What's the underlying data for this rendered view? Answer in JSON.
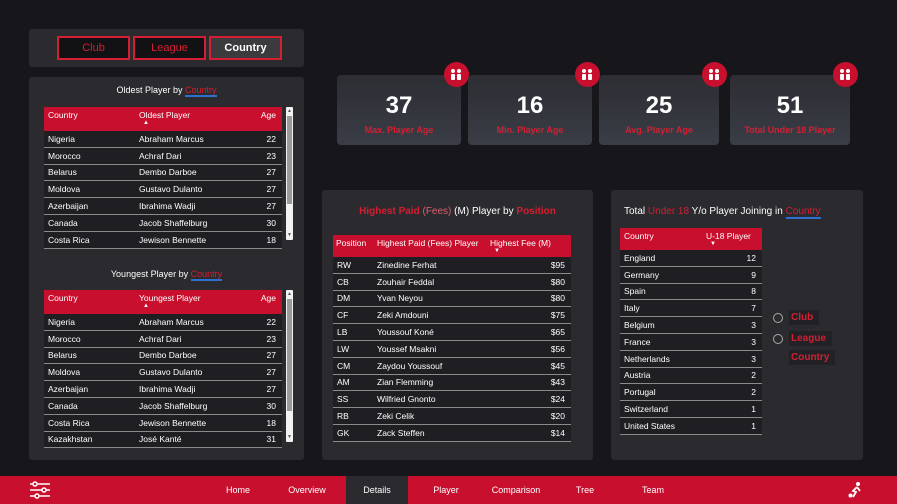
{
  "slicer": {
    "club": "Club",
    "league": "League",
    "country": "Country"
  },
  "oldest": {
    "title_prefix": "Oldest Player by ",
    "title_hl": "Country",
    "headers": {
      "country": "Country",
      "player": "Oldest Player",
      "age": "Age"
    },
    "rows": [
      {
        "country": "Nigeria",
        "player": "Abraham Marcus",
        "age": "22"
      },
      {
        "country": "Morocco",
        "player": "Achraf Dari",
        "age": "23"
      },
      {
        "country": "Belarus",
        "player": "Dembo Darboe",
        "age": "27"
      },
      {
        "country": "Moldova",
        "player": "Gustavo Dulanto",
        "age": "27"
      },
      {
        "country": "Azerbaijan",
        "player": "Ibrahima Wadji",
        "age": "27"
      },
      {
        "country": "Canada",
        "player": "Jacob Shaffelburg",
        "age": "30"
      },
      {
        "country": "Costa Rica",
        "player": "Jewison Bennette",
        "age": "18"
      }
    ]
  },
  "youngest": {
    "title_prefix": "Youngest Player by ",
    "title_hl": "Country",
    "headers": {
      "country": "Country",
      "player": "Youngest Player",
      "age": "Age"
    },
    "rows": [
      {
        "country": "Nigeria",
        "player": "Abraham Marcus",
        "age": "22"
      },
      {
        "country": "Morocco",
        "player": "Achraf Dari",
        "age": "23"
      },
      {
        "country": "Belarus",
        "player": "Dembo Darboe",
        "age": "27"
      },
      {
        "country": "Moldova",
        "player": "Gustavo Dulanto",
        "age": "27"
      },
      {
        "country": "Azerbaijan",
        "player": "Ibrahima Wadji",
        "age": "27"
      },
      {
        "country": "Canada",
        "player": "Jacob Shaffelburg",
        "age": "30"
      },
      {
        "country": "Costa Rica",
        "player": "Jewison Bennette",
        "age": "18"
      },
      {
        "country": "Kazakhstan",
        "player": "José Kanté",
        "age": "31"
      }
    ]
  },
  "kpis": [
    {
      "value": "37",
      "label": "Max. Player Age"
    },
    {
      "value": "16",
      "label": "Min. Player Age"
    },
    {
      "value": "25",
      "label": "Avg. Player Age"
    },
    {
      "value": "51",
      "label": "Total Under 18 Player"
    }
  ],
  "paid": {
    "t1": "Highest Paid ",
    "t2": "(Fees)",
    "t3": " (M) Player by ",
    "t4": "Position",
    "headers": {
      "position": "Position",
      "player": "Highest Paid (Fees) Player",
      "fee": "Highest Fee (M)"
    },
    "rows": [
      {
        "position": "RW",
        "player": "Zinedine Ferhat",
        "fee": "$95"
      },
      {
        "position": "CB",
        "player": "Zouhair Feddal",
        "fee": "$80"
      },
      {
        "position": "DM",
        "player": "Yvan Neyou",
        "fee": "$80"
      },
      {
        "position": "CF",
        "player": "Zeki Amdouni",
        "fee": "$75"
      },
      {
        "position": "LB",
        "player": "Youssouf Koné",
        "fee": "$65"
      },
      {
        "position": "LW",
        "player": "Youssef Msakni",
        "fee": "$56"
      },
      {
        "position": "CM",
        "player": "Zaydou Youssouf",
        "fee": "$45"
      },
      {
        "position": "AM",
        "player": "Zian Flemming",
        "fee": "$43"
      },
      {
        "position": "SS",
        "player": "Wilfried Gnonto",
        "fee": "$24"
      },
      {
        "position": "RB",
        "player": "Zeki Celik",
        "fee": "$20"
      },
      {
        "position": "GK",
        "player": "Zack Steffen",
        "fee": "$14"
      }
    ]
  },
  "under18": {
    "t1": "Total ",
    "t2": "Under 18",
    "t3": " Y/o Player Joining in ",
    "t4": "Country",
    "headers": {
      "country": "Country",
      "count": "U-18 Player"
    },
    "rows": [
      {
        "country": "England",
        "count": "12"
      },
      {
        "country": "Germany",
        "count": "9"
      },
      {
        "country": "Spain",
        "count": "8"
      },
      {
        "country": "Italy",
        "count": "7"
      },
      {
        "country": "Belgium",
        "count": "3"
      },
      {
        "country": "France",
        "count": "3"
      },
      {
        "country": "Netherlands",
        "count": "3"
      },
      {
        "country": "Austria",
        "count": "2"
      },
      {
        "country": "Portugal",
        "count": "2"
      },
      {
        "country": "Switzerland",
        "count": "1"
      },
      {
        "country": "United States",
        "count": "1"
      }
    ],
    "radio": {
      "club": "Club",
      "league": "League",
      "country": "Country"
    }
  },
  "nav": {
    "home": "Home",
    "overview": "Overview",
    "details": "Details",
    "player": "Player",
    "comparison": "Comparison",
    "tree": "Tree",
    "team": "Team"
  },
  "colors": {
    "accent": "#c8102e",
    "background": "#17171b",
    "panel": "#2a2a2f"
  }
}
